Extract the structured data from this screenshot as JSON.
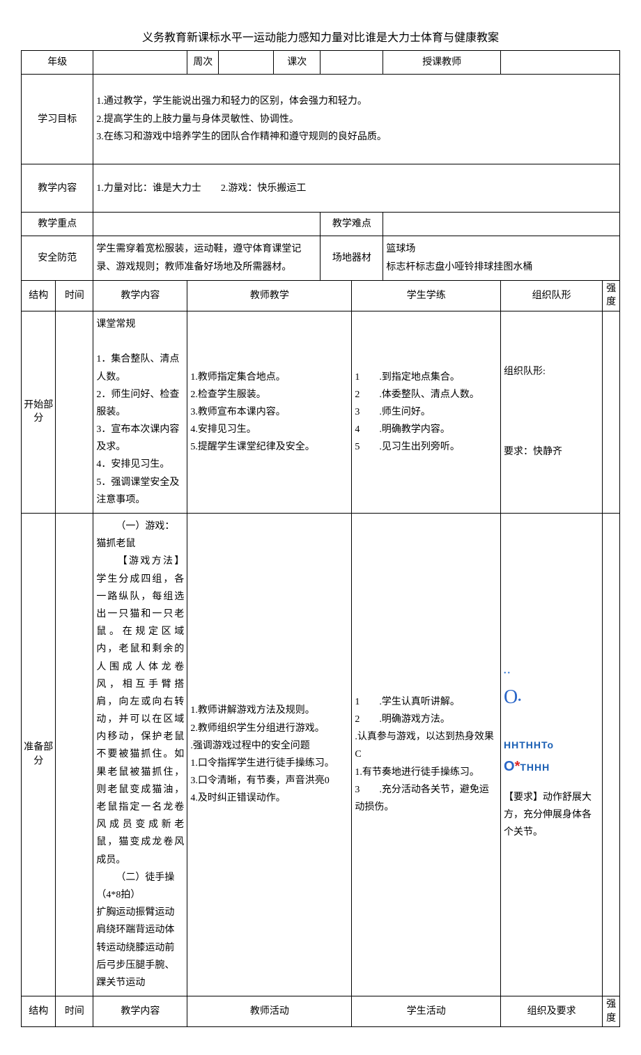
{
  "title": "义务教育新课标水平一运动能力感知力量对比谁是大力士体育与健康教案",
  "header": {
    "grade_label": "年级",
    "week_label": "周次",
    "lesson_label": "课次",
    "teacher_label": "授课教师"
  },
  "objectives": {
    "label": "学习目标",
    "line1": "1.通过教学，学生能说出强力和轻力的区别，体会强力和轻力。",
    "line2": "2.提高学生的上肢力量与身体灵敏性、协调性。",
    "line3": "3.在练习和游戏中培养学生的团队合作精神和遵守规则的良好品质。"
  },
  "content": {
    "label": "教学内容",
    "text": "1.力量对比：谁是大力士  2.游戏：快乐搬运工"
  },
  "focus": {
    "key_label": "教学重点",
    "diff_label": "教学难点"
  },
  "safety": {
    "label": "安全防范",
    "text": "学生需穿着宽松服装，运动鞋，遵守体育课堂记录、游戏规则；教师准备好场地及所需器材。",
    "equip_label": "场地器材",
    "equip_text": "篮球场\n标志杆标志盘小哑铃排球挂图水桶"
  },
  "cols": {
    "struct": "结构",
    "time": "时间",
    "jxnr": "教学内容",
    "jsjx": "教师教学",
    "xsxl": "学生学练",
    "zzdx": "组织队形",
    "qd": "强度",
    "jshd": "教师活动",
    "xshd": "学生活动",
    "zzjyq": "组织及要求"
  },
  "start": {
    "section": "开始部分",
    "jxnr": "课堂常规\n\n1．集合整队、清点人数。\n2．师生问好、检查服装。\n3．宣布本次课内容及求。\n4．安排见习生。\n5．强调课堂安全及注意事项。",
    "jsjx": "1.教师指定集合地点。\n2.检查学生服装。\n3.教师宣布本课内容。\n4.安排见习生。\n5.提醒学生课堂纪律及安全。",
    "xsxl": "1  .到指定地点集合。\n2  .体委整队、清点人数。\n3  .师生问好。\n4  .明确教学内容。\n5  .见习生出列旁听。",
    "zzdx_top": "组织队形:",
    "zzdx_bottom": "要求：快静齐"
  },
  "prep": {
    "section": "准备部分",
    "jxnr_p1": "（一）游戏：猫抓老鼠",
    "jxnr_p2": "【游戏方法】学生分成四组，各一路纵队，每组选出一只猫和一只老鼠。在规定区域内，老鼠和剩余的人围成人体龙卷风，相互手臂搭肩，向左或向右转动，并可以在区域内移动，保护老鼠不要被猫抓住。如果老鼠被猫抓住，则老鼠变成猫油，老鼠指定一名龙卷风成员变成新老鼠，猫变成龙卷风成员。",
    "jxnr_p3": "（二）徒手操（4*8拍）",
    "jxnr_p4": "扩胸运动振臂运动肩绕环踹背运动体转运动绕膝运动前后弓步压腿手腕、踝关节运动",
    "jsjx": "1.教师讲解游戏方法及规则。\n2.教师组织学生分组进行游戏。\n.强调游戏过程中的安全问题\n1.口令指挥学生进行徒手操练习。\n3.口令清晰，有节奏，声音洪亮0\n4.及时纠正错误动作。",
    "xsxl": "1  .学生认真听讲解。\n2  .明确游戏方法。\n.认真参与游戏，以达到热身效果C\n1.有节奏地进行徒手操练习。\n3  .充分活动各关节，避免运动损伤。",
    "zzdx_shapes1": "HHTHHTo",
    "zzdx_shapes2": "O*THHH",
    "zzdx_req": "【要求】动作舒展大方，充分伸展身体各个关节。"
  }
}
